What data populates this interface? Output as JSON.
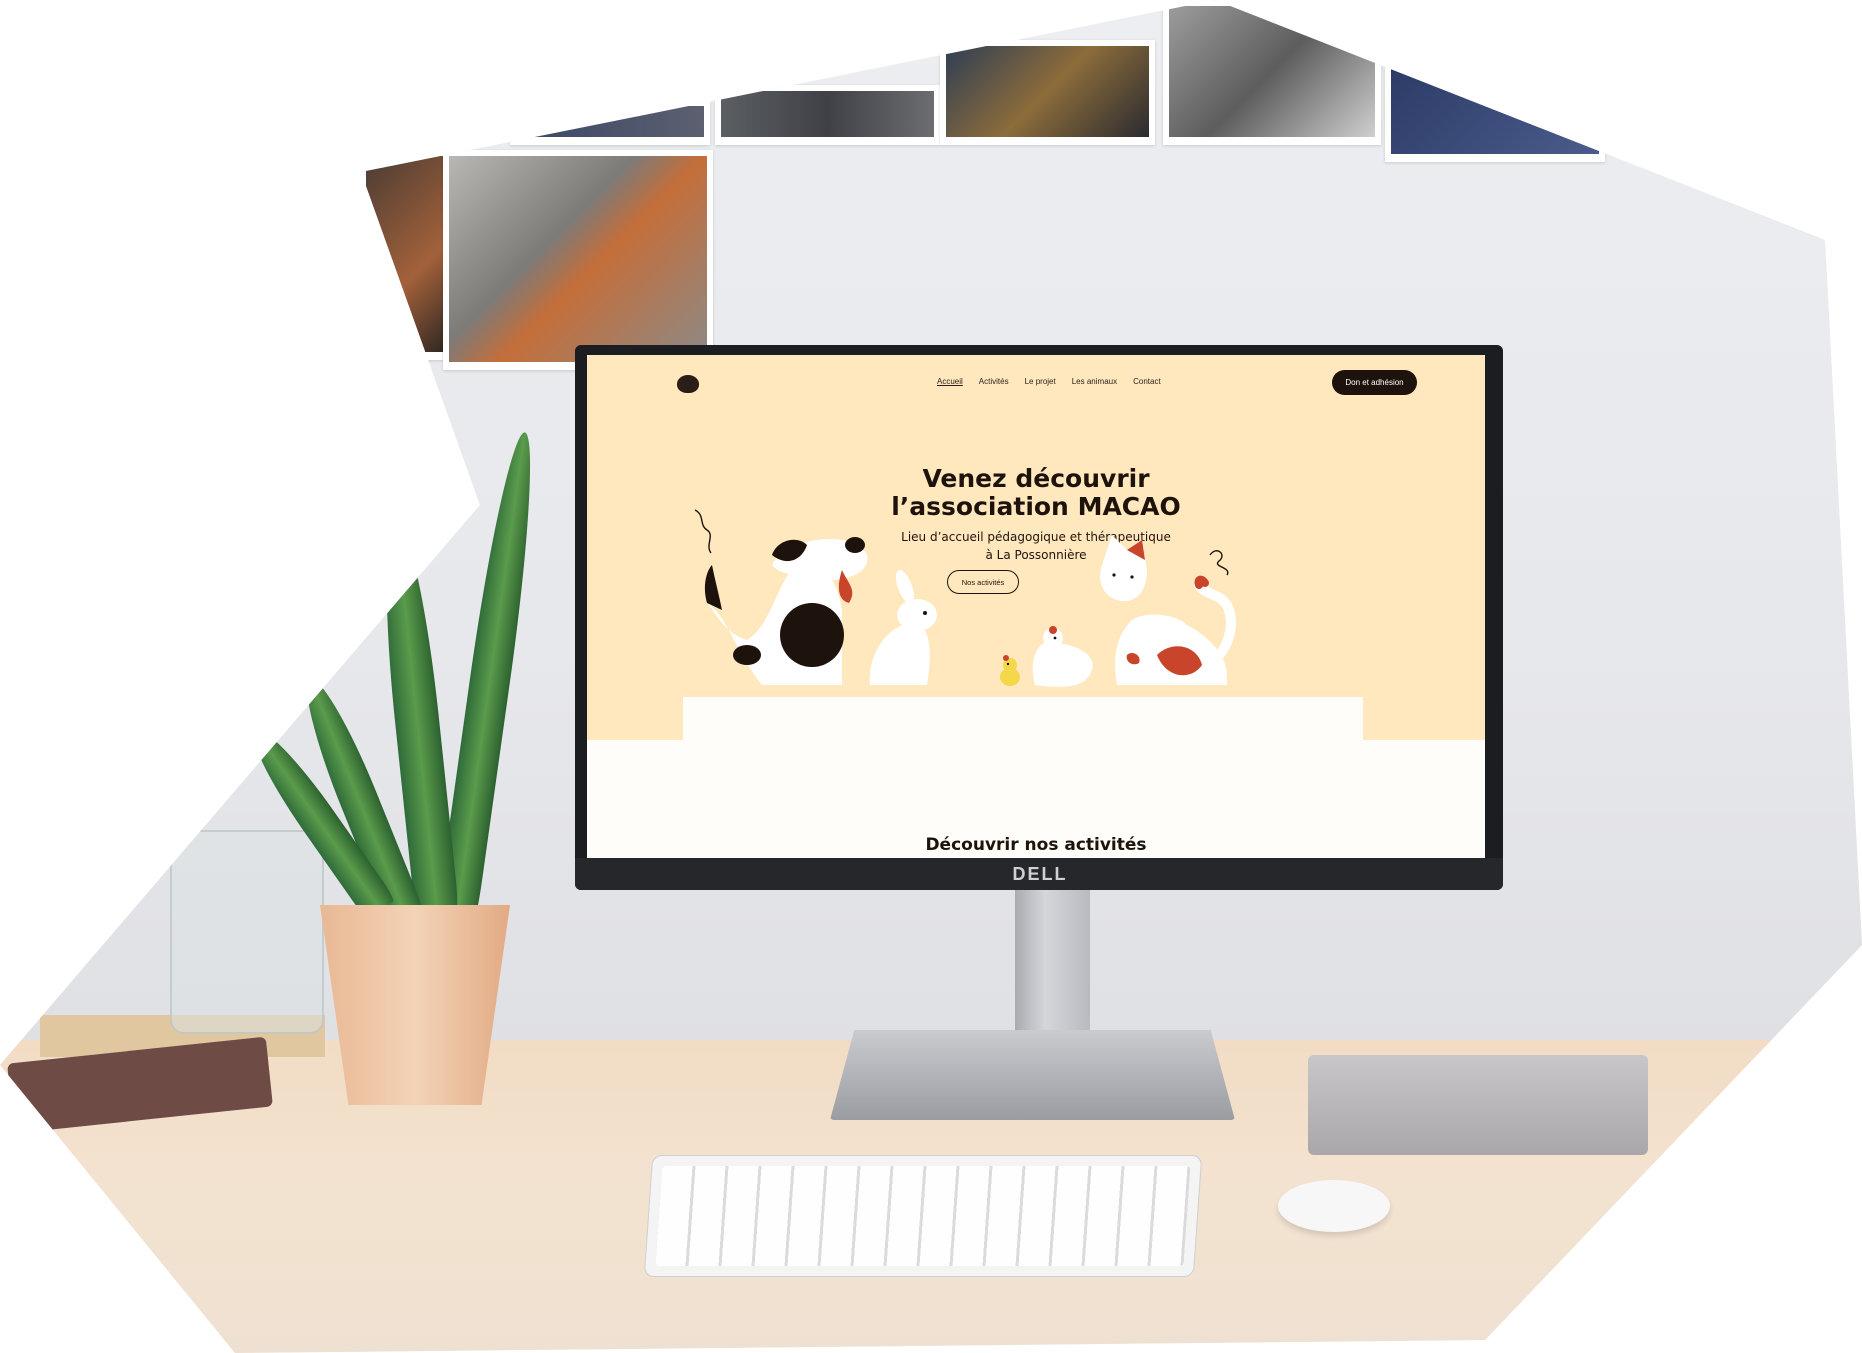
{
  "website": {
    "nav": {
      "items": [
        {
          "label": "Accueil",
          "active": true
        },
        {
          "label": "Activités",
          "active": false
        },
        {
          "label": "Le projet",
          "active": false
        },
        {
          "label": "Les animaux",
          "active": false
        },
        {
          "label": "Contact",
          "active": false
        }
      ],
      "cta_label": "Don et adhésion"
    },
    "hero": {
      "title_line1": "Venez découvrir",
      "title_line2": "l’association MACAO",
      "subtitle_line1": "Lieu d’accueil pédagogique et thérapeutique",
      "subtitle_line2": "à La Possonnière",
      "button_label": "Nos activités"
    },
    "next_section_title": "Découvrir nos activités"
  },
  "monitor": {
    "brand": "DELL"
  },
  "colors": {
    "site_background": "#ffe7be",
    "dark": "#1e130c",
    "cat_spots": "#c8442a",
    "chick": "#f4d84a"
  }
}
